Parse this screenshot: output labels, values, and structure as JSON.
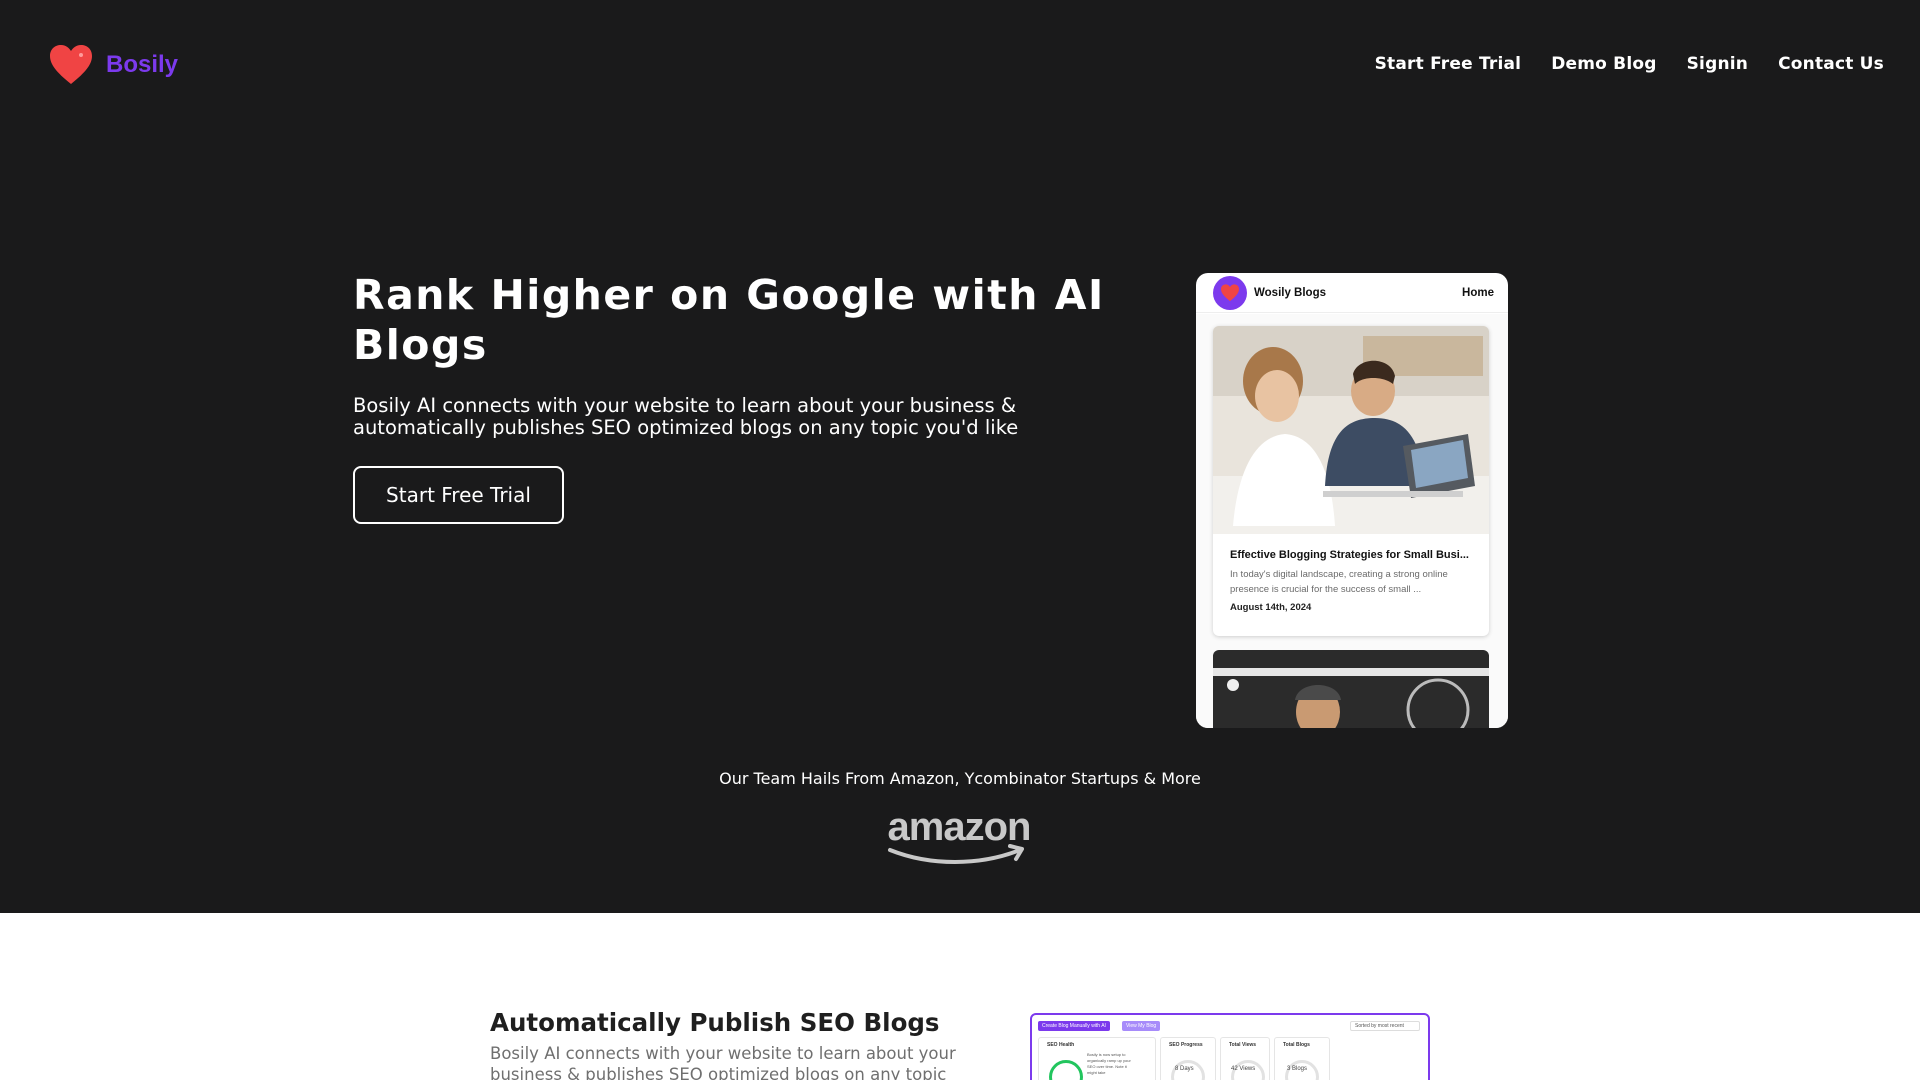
{
  "brand": {
    "name": "Bosily"
  },
  "nav": {
    "items": [
      "Start Free Trial",
      "Demo Blog",
      "Signin",
      "Contact Us"
    ]
  },
  "hero": {
    "title": "Rank Higher on Google with AI Blogs",
    "subtitle": "Bosily AI connects with your website to learn about your business & automatically publishes SEO optimized blogs on any topic you'd like",
    "cta_label": "Start Free Trial"
  },
  "mock_blog": {
    "brand": "Wosily Blogs",
    "home_link": "Home",
    "post": {
      "title": "Effective Blogging Strategies for Small Busi...",
      "excerpt": "In today's digital landscape, creating a strong online presence is crucial for the success of small ...",
      "date": "August 14th, 2024"
    }
  },
  "trust": {
    "text": "Our Team Hails From Amazon, Ycombinator Startups & More",
    "logo": "amazon"
  },
  "feature": {
    "title": "Automatically Publish SEO Blogs",
    "text": "Bosily AI connects with your website to learn about your business & publishes SEO optimized blogs on any topic"
  },
  "dashboard": {
    "create_button": "Create Blog Manually with AI",
    "view_button": "View My Blog",
    "sort_label": "Sorted by most recent",
    "cards": [
      {
        "label": "SEO Health",
        "note": "Bosily is now setup to organically ramp up your SEO over time. Note it might take"
      },
      {
        "label": "SEO Progress",
        "value": "8 Days"
      },
      {
        "label": "Total Views",
        "value": "42 Views"
      },
      {
        "label": "Total Blogs",
        "value": "3 Blogs"
      }
    ]
  },
  "colors": {
    "hero_bg": "#1a1a1b",
    "accent": "#7c3aed",
    "heart": "#ef4444"
  }
}
